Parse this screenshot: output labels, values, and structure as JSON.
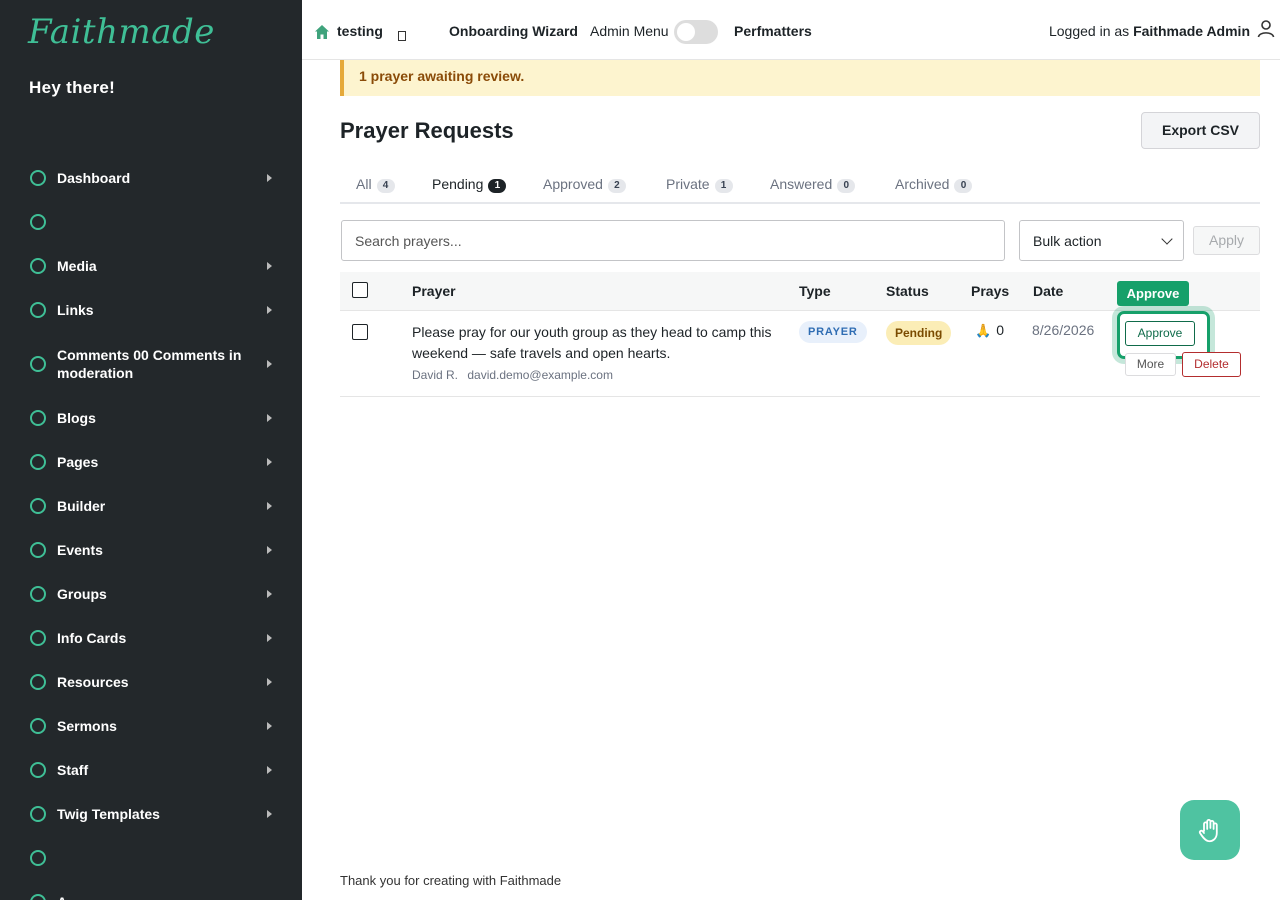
{
  "sidebar": {
    "logo": "Faithmade",
    "greeting": "Hey there!",
    "items": [
      {
        "label": "Dashboard",
        "has_arrow": true
      },
      {
        "label": "",
        "has_arrow": false
      },
      {
        "label": "Media",
        "has_arrow": true
      },
      {
        "label": "Links",
        "has_arrow": true
      },
      {
        "label": "Comments 00 Comments in moderation",
        "has_arrow": true
      },
      {
        "label": "Blogs",
        "has_arrow": true
      },
      {
        "label": "Pages",
        "has_arrow": true
      },
      {
        "label": "Builder",
        "has_arrow": true
      },
      {
        "label": "Events",
        "has_arrow": true
      },
      {
        "label": "Groups",
        "has_arrow": true
      },
      {
        "label": "Info Cards",
        "has_arrow": true
      },
      {
        "label": "Resources",
        "has_arrow": true
      },
      {
        "label": "Sermons",
        "has_arrow": true
      },
      {
        "label": "Staff",
        "has_arrow": true
      },
      {
        "label": "Twig Templates",
        "has_arrow": true
      },
      {
        "label": "",
        "has_arrow": false
      },
      {
        "label": "A...",
        "has_arrow": false
      }
    ]
  },
  "topbar": {
    "site_name": "testing",
    "onboarding": "Onboarding Wizard",
    "admin_menu": "Admin Menu",
    "perfmatters": "Perfmatters",
    "logged_in_prefix": "Logged in as ",
    "logged_in_user": "Faithmade Admin"
  },
  "notice": {
    "text": "1 prayer awaiting review."
  },
  "page": {
    "title": "Prayer Requests",
    "export_label": "Export CSV"
  },
  "tabs": [
    {
      "label": "All",
      "count": "4"
    },
    {
      "label": "Pending",
      "count": "1"
    },
    {
      "label": "Approved",
      "count": "2"
    },
    {
      "label": "Private",
      "count": "1"
    },
    {
      "label": "Answered",
      "count": "0"
    },
    {
      "label": "Archived",
      "count": "0"
    }
  ],
  "filters": {
    "search_placeholder": "Search prayers...",
    "bulk_action": "Bulk action",
    "apply_label": "Apply"
  },
  "table": {
    "headers": {
      "prayer": "Prayer",
      "type": "Type",
      "status": "Status",
      "prays": "Prays",
      "date": "Date"
    },
    "rows": [
      {
        "text": "Please pray for our youth group as they head to camp this weekend — safe travels and open hearts.",
        "author": "David R.",
        "email": "david.demo@example.com",
        "type": "PRAYER",
        "status": "Pending",
        "prays_icon": "🙏",
        "prays": "0",
        "date": "8/26/2026",
        "actions": {
          "approve": "Approve",
          "more": "More",
          "delete": "Delete"
        }
      }
    ]
  },
  "tooltip": {
    "text": "Approve"
  },
  "footer": {
    "text": "Thank you for creating with Faithmade"
  },
  "colors": {
    "sidebar_bg": "#23282b",
    "accent": "#3fbf96",
    "approve": "#16a06a",
    "delete": "#b32d2e"
  },
  "icons": [
    "home-icon",
    "user-icon",
    "chevron-right-icon",
    "chevron-down-icon",
    "hand-wave-icon"
  ]
}
